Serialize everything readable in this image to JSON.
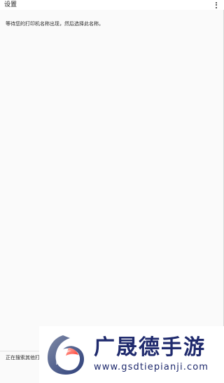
{
  "topbar": {
    "title": "设置",
    "more_icon": "more-vert-icon"
  },
  "content": {
    "message": "等待您的打印机名称出现，然后选择此名称。"
  },
  "footer": {
    "status_text": "正在搜索其他打"
  },
  "watermark": {
    "brand": "广晟德手游",
    "url": "www.gsdtiepianji.com",
    "colors": {
      "brand": "#1f2a6d",
      "accent": "#ff3b30"
    }
  },
  "colors": {
    "background": "#fafafa",
    "topbar": "#ffffff",
    "text": "#2a2a2a"
  }
}
